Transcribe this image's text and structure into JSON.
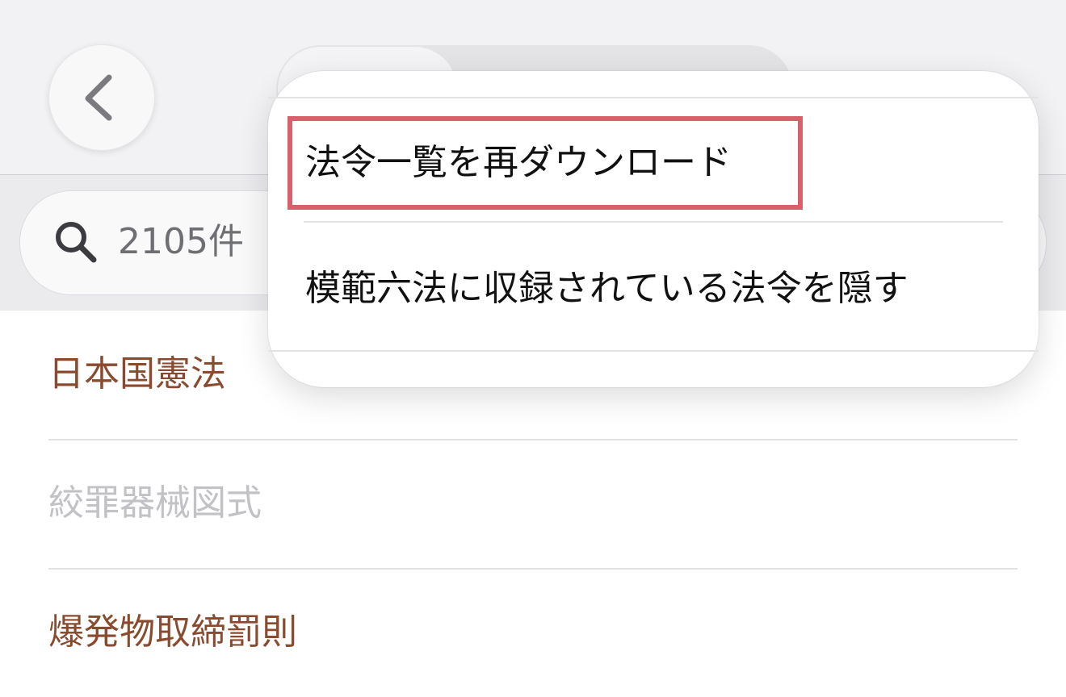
{
  "search": {
    "count_label": "2105件"
  },
  "list": {
    "items": [
      {
        "label": "日本国憲法",
        "color": "#8a4a2e"
      },
      {
        "label": "絞罪器械図式",
        "color": "#c2c2c6"
      },
      {
        "label": "爆発物取締罰則",
        "color": "#8a4a2e"
      }
    ]
  },
  "menu": {
    "items": [
      {
        "label": "法令一覧を再ダウンロード"
      },
      {
        "label": "模範六法に収録されている法令を隠す"
      }
    ]
  },
  "colors": {
    "highlight": "#d9606b",
    "law_link": "#8a4a2e",
    "law_disabled": "#c2c2c6"
  },
  "icons": {
    "back": "chevron-left-icon",
    "search": "magnifier-icon"
  }
}
